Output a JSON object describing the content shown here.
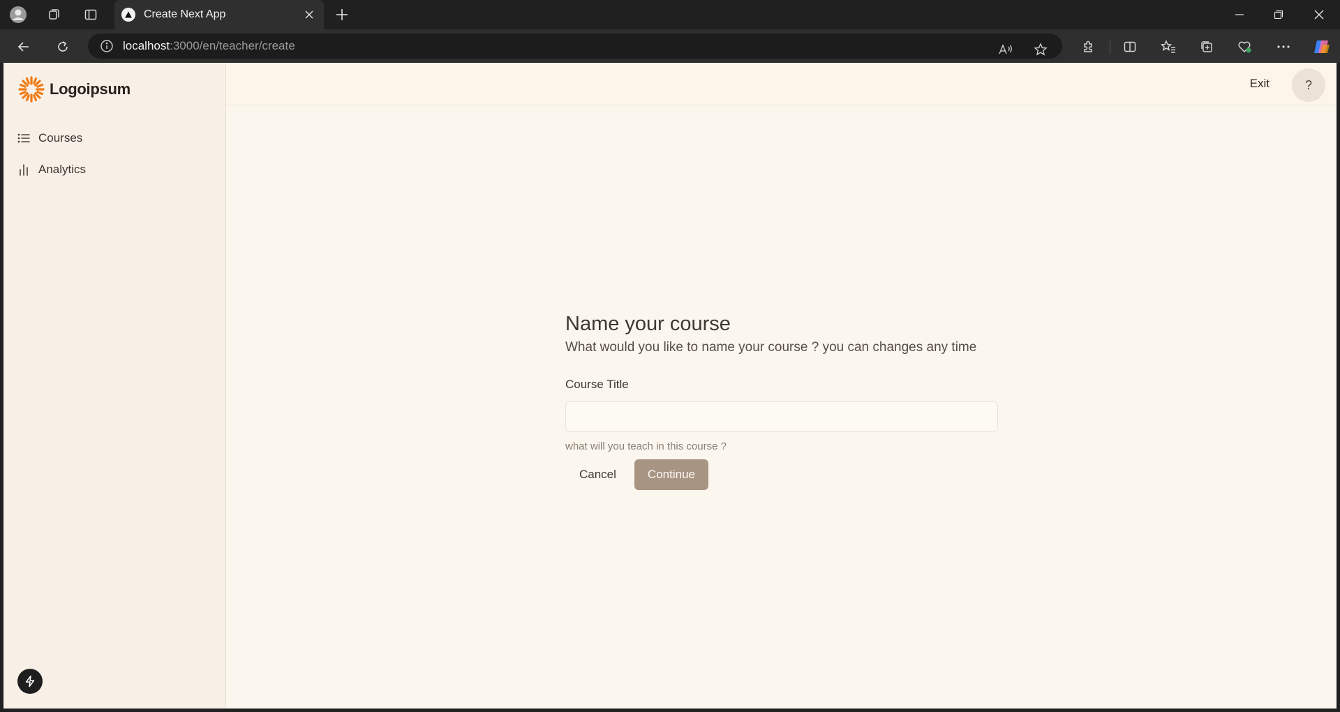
{
  "browser": {
    "tab_title": "Create Next App",
    "url_host": "localhost",
    "url_path": ":3000/en/teacher/create"
  },
  "sidebar": {
    "logo_text": "Logoipsum",
    "items": [
      {
        "label": "Courses",
        "icon": "list-icon"
      },
      {
        "label": "Analytics",
        "icon": "bar-chart-icon"
      }
    ]
  },
  "topbar": {
    "exit_label": "Exit",
    "help_label": "?"
  },
  "form": {
    "title": "Name your course",
    "subtitle": "What would you like to name your course ? you can changes any time",
    "field_label": "Course Title",
    "field_value": "",
    "hint": "what will you teach in this course ?",
    "cancel_label": "Cancel",
    "continue_label": "Continue"
  },
  "colors": {
    "accent": "#a89483",
    "logo_orange": "#f07a12",
    "page_bg": "#fbf6ee",
    "sidebar_bg": "#f8f0e6"
  }
}
